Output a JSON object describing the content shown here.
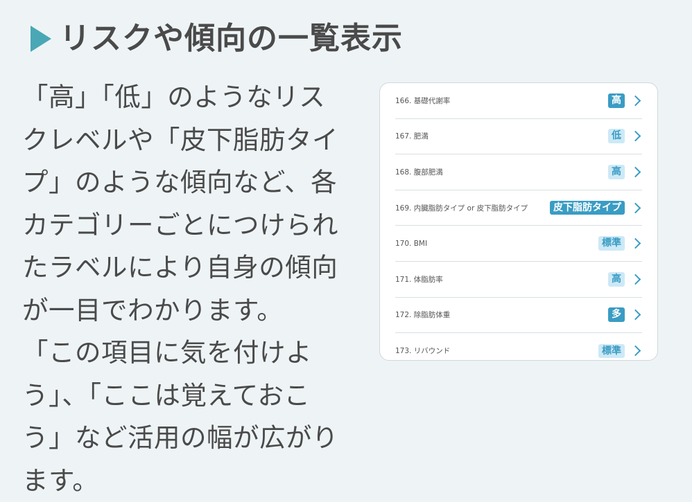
{
  "heading": {
    "title": "リスクや傾向の一覧表示"
  },
  "body": {
    "paragraph1": "「高」「低」のようなリスクレベルや「皮下脂肪タイプ」のような傾向など、各カテゴリーごとにつけられたラベルにより自身の傾向が一目でわかります。",
    "paragraph2": "「この項目に気を付けよう」、「ここは覚えておこう」など活用の幅が広がります。"
  },
  "panel": {
    "rows": [
      {
        "label": "166. 基礎代謝率",
        "badge": "高",
        "style": "solid"
      },
      {
        "label": "167. 肥満",
        "badge": "低",
        "style": "light"
      },
      {
        "label": "168. 腹部肥満",
        "badge": "高",
        "style": "light"
      },
      {
        "label": "169. 内臓脂肪タイプ or 皮下脂肪タイプ",
        "badge": "皮下脂肪タイプ",
        "style": "solid"
      },
      {
        "label": "170. BMI",
        "badge": "標準",
        "style": "light"
      },
      {
        "label": "171. 体脂肪率",
        "badge": "高",
        "style": "light"
      },
      {
        "label": "172. 除脂肪体重",
        "badge": "多",
        "style": "solid"
      },
      {
        "label": "173. リバウンド",
        "badge": "標準",
        "style": "light"
      }
    ]
  },
  "colors": {
    "accent": "#4aa7b5",
    "badge_solid": "#3a9cc4",
    "badge_light": "#cde9f6",
    "background": "#eef4f6"
  }
}
